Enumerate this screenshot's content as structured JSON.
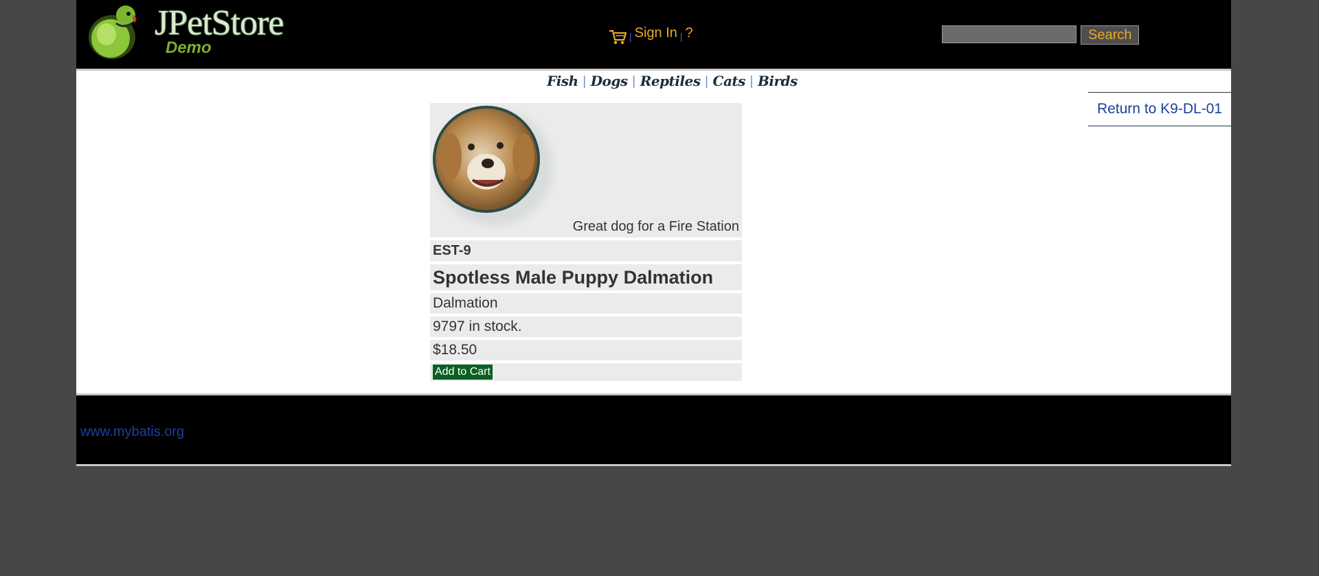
{
  "header": {
    "logo_text": "JPetStore",
    "logo_subtext": "Demo",
    "menu": {
      "sign_in": "Sign In",
      "help": "?"
    },
    "search": {
      "placeholder": "",
      "button_label": "Search"
    }
  },
  "quick_links": [
    "Fish",
    "Dogs",
    "Reptiles",
    "Cats",
    "Birds"
  ],
  "back_link": "Return to K9-DL-01",
  "item": {
    "image_caption": "Great dog for a Fire Station",
    "id": "EST-9",
    "name": "Spotless Male Puppy Dalmation",
    "product": "Dalmation",
    "stock": "9797 in stock.",
    "price": "$18.50",
    "add_to_cart": "Add to Cart"
  },
  "footer": {
    "link": "www.mybatis.org"
  },
  "colors": {
    "page_bg": "#474747",
    "header_bg": "#000000",
    "accent": "#e8a92a",
    "link": "#1d3f9e",
    "add_cart_bg": "#0a5f24"
  }
}
